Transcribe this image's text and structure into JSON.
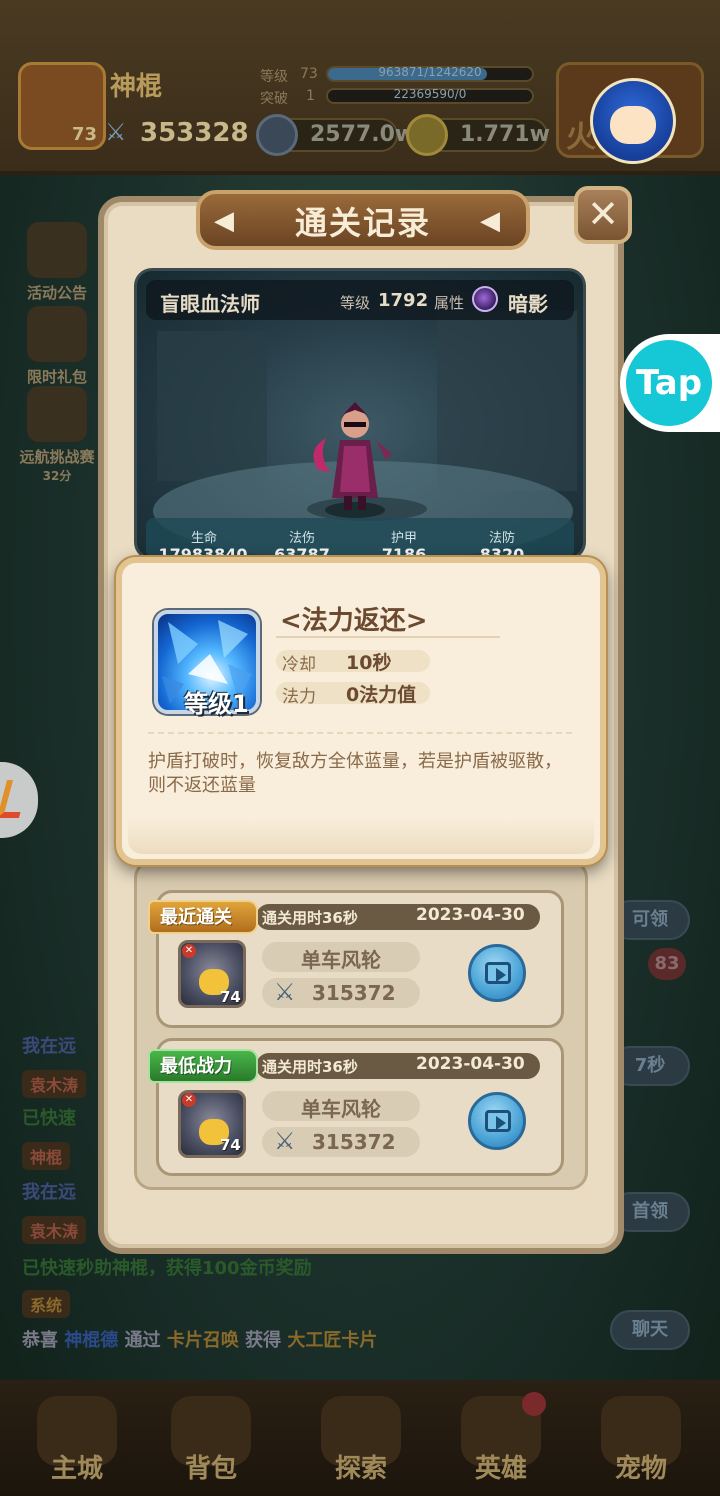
{
  "background": {
    "player": {
      "name": "神棍",
      "level": "73",
      "power": "353328"
    },
    "stats": {
      "level_label": "等级",
      "level_value": "73",
      "level_bar_text": "963871/1242620",
      "level_fraction": 0.78,
      "break_label": "突破",
      "break_value": "1",
      "break_bar_text": "22369590/0"
    },
    "currency": {
      "silver": "2577.0w",
      "gold": "1.771w"
    },
    "mascot_label": "火",
    "sidebar": [
      {
        "label": "活动公告"
      },
      {
        "label": "限时礼包"
      },
      {
        "label": "远航挑战赛",
        "sub": "32分"
      }
    ],
    "right_buttons": [
      "可领",
      "7秒",
      "首领",
      "聊天"
    ],
    "right_badge": "83",
    "chat": {
      "lines": [
        {
          "tag": "",
          "text": "我在远"
        },
        {
          "tag": "袁木涛",
          "text": ""
        },
        {
          "tag": "",
          "text": "已快速"
        },
        {
          "tag": "神棍",
          "text": ""
        },
        {
          "tag": "",
          "text": "我在远"
        },
        {
          "tag": "袁木涛",
          "text": ""
        },
        {
          "tag": "",
          "text": "已快速秒助神棍，获得100金币奖励"
        },
        {
          "tag": "系统",
          "text": ""
        }
      ],
      "system_msg": {
        "prefix": "恭喜",
        "name": "神棍德",
        "mid1": "通过",
        "source": "卡片召唤",
        "mid2": "获得",
        "item": "大工匠卡片"
      }
    },
    "bottom_nav": [
      "主城",
      "背包",
      "探索",
      "英雄",
      "宠物"
    ]
  },
  "panel": {
    "title": "通关记录",
    "close_symbol": "✕",
    "title_deco_left": "◀",
    "title_deco_right": "◀",
    "boss": {
      "name": "盲眼血法师",
      "level_label": "等级",
      "level": "1792",
      "attr_label": "属性",
      "attr_value": "暗影",
      "stats": [
        {
          "label": "生命",
          "value": "17983840"
        },
        {
          "label": "法伤",
          "value": "63787"
        },
        {
          "label": "护甲",
          "value": "7186"
        },
        {
          "label": "法防",
          "value": "8320"
        }
      ]
    },
    "skill": {
      "name": "<法力返还>",
      "level_text": "等级1",
      "cooldown_label": "冷却",
      "cooldown_value": "10秒",
      "mana_label": "法力",
      "mana_value": "0法力值",
      "description": "护盾打破时，恢复敌方全体蓝量，若是护盾被驱散，则不返还蓝量"
    },
    "records": [
      {
        "tag": "最近通关",
        "tag_color": "#e0a43a",
        "time": "通关用时36秒",
        "date": "2023-04-30",
        "player": "单车风轮",
        "power": "315372",
        "hero_level": "74"
      },
      {
        "tag": "最低战力",
        "tag_color": "#49b649",
        "time": "通关用时36秒",
        "date": "2023-04-30",
        "player": "单车风轮",
        "power": "315372",
        "hero_level": "74"
      }
    ]
  },
  "overlay": {
    "tap_label": "Tap"
  }
}
